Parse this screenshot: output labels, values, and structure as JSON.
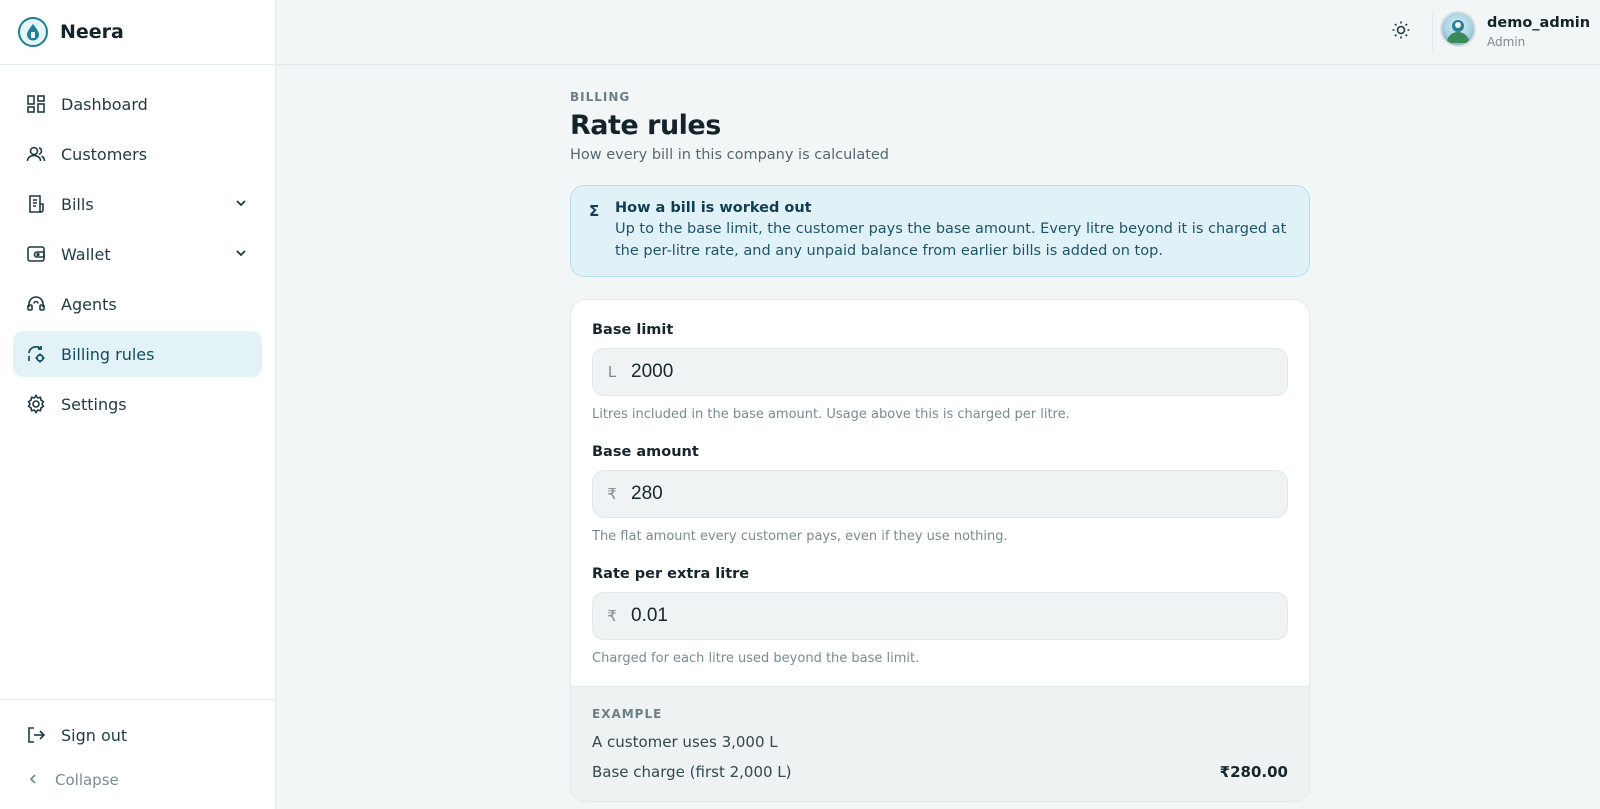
{
  "brand": {
    "name": "Neera"
  },
  "sidebar": {
    "items": [
      {
        "label": "Dashboard",
        "icon": "dashboard-icon"
      },
      {
        "label": "Customers",
        "icon": "users-icon"
      },
      {
        "label": "Bills",
        "icon": "receipt-icon"
      },
      {
        "label": "Wallet",
        "icon": "wallet-icon"
      },
      {
        "label": "Agents",
        "icon": "headset-icon"
      },
      {
        "label": "Billing rules",
        "icon": "billing-rules-icon"
      },
      {
        "label": "Settings",
        "icon": "gear-icon"
      }
    ],
    "sign_out": "Sign out",
    "collapse": "Collapse"
  },
  "user": {
    "name": "demo_admin",
    "role": "Admin"
  },
  "page": {
    "eyebrow": "BILLING",
    "title": "Rate rules",
    "subtitle": "How every bill in this company is calculated"
  },
  "info": {
    "symbol": "Σ",
    "title": "How a bill is worked out",
    "body": "Up to the base limit, the customer pays the base amount. Every litre beyond it is charged at the per-litre rate, and any unpaid balance from earlier bills is added on top."
  },
  "fields": {
    "base_limit": {
      "label": "Base limit",
      "prefix": "L",
      "value": "2000",
      "hint": "Litres included in the base amount. Usage above this is charged per litre."
    },
    "base_amount": {
      "label": "Base amount",
      "prefix": "₹",
      "value": "280",
      "hint": "The flat amount every customer pays, even if they use nothing."
    },
    "rate": {
      "label": "Rate per extra litre",
      "prefix": "₹",
      "value": "0.01",
      "hint": "Charged for each litre used beyond the base limit."
    }
  },
  "example": {
    "eyebrow": "EXAMPLE",
    "line1": "A customer uses 3,000 L",
    "row1_label": "Base charge (first 2,000 L)",
    "row1_amount": "₹280.00"
  },
  "colors": {
    "accent": "#0f4d60",
    "active_bg": "#e3f2f7",
    "info_bg": "#e0f2f8"
  }
}
